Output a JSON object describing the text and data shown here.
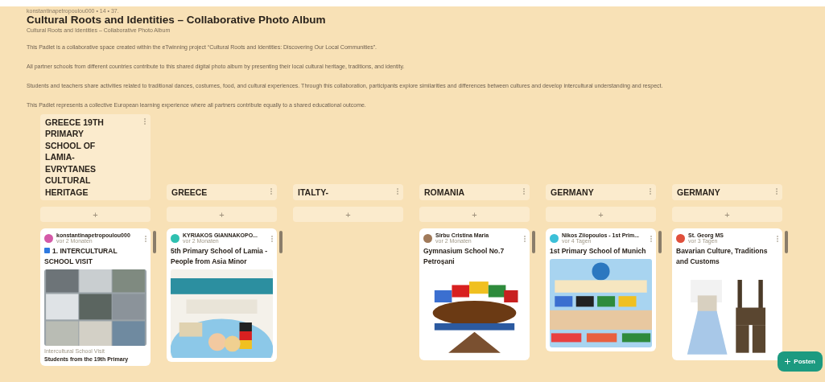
{
  "board": {
    "meta": "konstantinapetropoulou000 • 14 • 37.",
    "title": "Cultural Roots and Identities – Collaborative Photo Album",
    "subtitle": "Cultural Roots and Identities – Collaborative Photo Album",
    "description": [
      "This Padlet is a collaborative space created within the eTwinning project “Cultural Roots and Identities: Discovering Our Local Communities”.",
      "All partner schools from different countries contribute to this shared digital photo album by presenting their local cultural heritage, traditions, and identity.",
      "Students and teachers share activities related to traditional dances, costumes, food, and cultural experiences. Through this collaboration, participants explore similarities and differences between cultures and develop intercultural understanding and respect.",
      "This Padlet represents a collective European learning experience where all partners contribute equally to a shared educational outcome."
    ]
  },
  "columns": [
    {
      "title": "GREECE 19TH PRIMARY SCHOOL OF LAMIA-EVRYTANES CULTURAL HERITAGE",
      "add_label": "+",
      "cards": [
        {
          "author": "konstantinapetropoulou000",
          "time": "vor 2 Monaten",
          "color": "#d45aa8",
          "title_icon": true,
          "title": "1. INTERCULTURAL SCHOOL VISIT",
          "caption": "Intercultural School Visit",
          "body": "Students from the 19th Primary"
        }
      ]
    },
    {
      "title": "GREECE",
      "add_label": "+",
      "cards": [
        {
          "author": "KYRIAKOS GIANNAKOPO...",
          "time": "vor 2 Monaten",
          "color": "#2fc0b0",
          "title": "5th Primary School of Lamia - People from Asia Minor"
        }
      ]
    },
    {
      "title": "ITALTY-",
      "add_label": "+"
    },
    {
      "title": "ROMANIA",
      "add_label": "+",
      "cards": [
        {
          "author": "Sirbu Cristina Maria",
          "time": "vor 2 Monaten",
          "color": "#a07a5a",
          "title": "Gymnasium School No.7 Petroșani"
        }
      ]
    },
    {
      "title": "GERMANY",
      "add_label": "+",
      "cards": [
        {
          "author": "Nikos Ziiopoulos - 1st Prim...",
          "time": "vor 4 Tagen",
          "color": "#3cc0d8",
          "title": "1st Primary School of Munich"
        }
      ]
    },
    {
      "title": "GERMANY",
      "add_label": "+",
      "cards": [
        {
          "author": "St. Georg MS",
          "time": "vor 3 Tagen",
          "color": "#e0503c",
          "title": "Bavarian Culture, Traditions and Customs"
        }
      ]
    }
  ],
  "post_button": {
    "label": "Posten"
  }
}
